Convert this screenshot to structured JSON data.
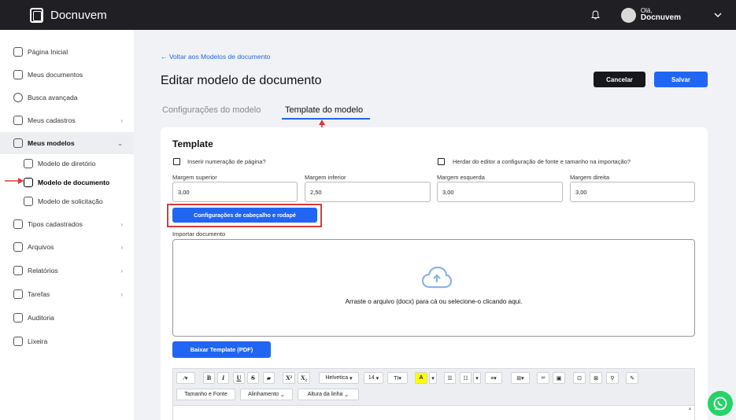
{
  "app": {
    "name": "Docnuvem"
  },
  "user": {
    "greeting": "Olá,",
    "name": "Docnuvem"
  },
  "sidebar": {
    "items": [
      {
        "label": "Página Inicial"
      },
      {
        "label": "Meus documentos"
      },
      {
        "label": "Busca avançada"
      },
      {
        "label": "Meus cadastros"
      },
      {
        "label": "Meus modelos"
      },
      {
        "label": "Modelo de diretório"
      },
      {
        "label": "Modelo de documento"
      },
      {
        "label": "Modelo de solicitação"
      },
      {
        "label": "Tipos cadastrados"
      },
      {
        "label": "Arquivos"
      },
      {
        "label": "Relatórios"
      },
      {
        "label": "Tarefas"
      },
      {
        "label": "Auditoria"
      },
      {
        "label": "Lixeira"
      }
    ]
  },
  "main": {
    "back_link": "← Voltar aos Modelos de documento",
    "title": "Editar modelo de documento",
    "cancel_label": "Cancelar",
    "save_label": "Salvar",
    "tabs": [
      {
        "label": "Configurações do modelo",
        "active": false
      },
      {
        "label": "Template do modelo",
        "active": true
      }
    ],
    "section_title": "Template",
    "checkbox_page_numbering": "Inserir numeração de página?",
    "checkbox_inherit_font": "Herdar do editor a configuração de fonte e tamanho na importação?",
    "fields": [
      {
        "label": "Margem superior",
        "value": "3,00"
      },
      {
        "label": "Margem inferior",
        "value": "2,50"
      },
      {
        "label": "Margem esquerda",
        "value": "3,00"
      },
      {
        "label": "Margem direita",
        "value": "3,00"
      }
    ],
    "header_footer_button": "Configurações de cabeçalho e rodapé",
    "import_label": "Importar documento",
    "drop_text": "Arraste o arquivo (docx) para cá ou selecione-o clicando aqui.",
    "download_template_button": "Baixar Template (PDF)"
  },
  "editor_toolbar": {
    "font_family": "Helvetica",
    "font_size": "14",
    "size_font_button": "Tamanho e Fonte",
    "alignment_button": "Alinhamento",
    "line_height_button": "Altura da linha"
  },
  "colors": {
    "accent": "#2166f3",
    "dark": "#17171c",
    "annotation_red": "#d93a3a",
    "whatsapp": "#25d366"
  }
}
